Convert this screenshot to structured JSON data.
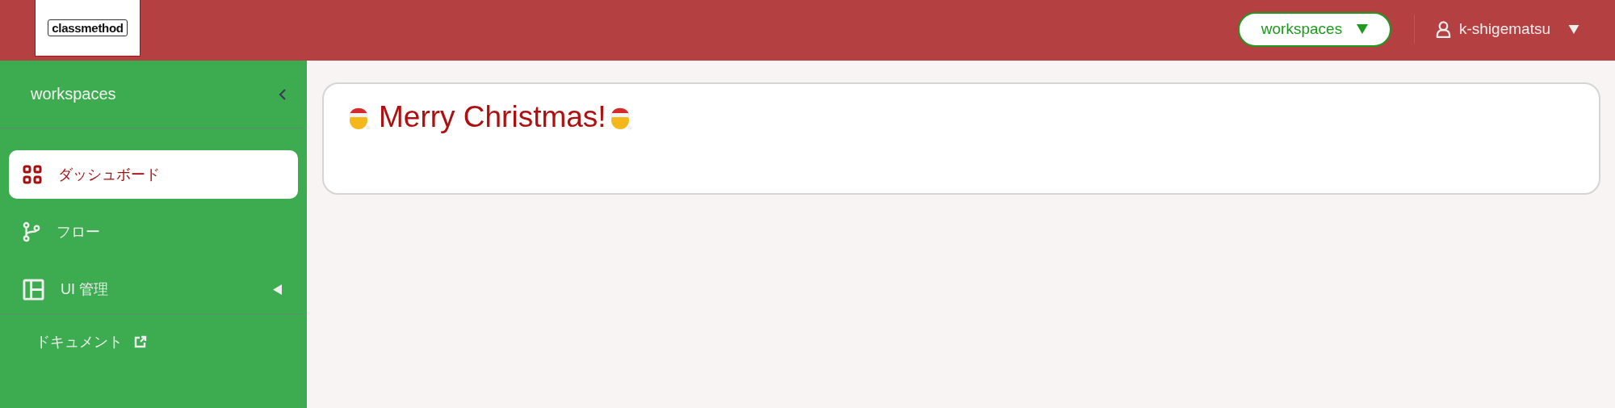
{
  "header": {
    "logo": "classmethod",
    "workspace_button": "workspaces",
    "user": "k-shigematsu"
  },
  "sidebar": {
    "title": "workspaces",
    "items": [
      {
        "label": "ダッシュボード",
        "selected": true
      },
      {
        "label": "フロー",
        "selected": false
      },
      {
        "label": "UI 管理",
        "selected": false,
        "expanded": false
      }
    ],
    "footer_link": "ドキュメント"
  },
  "card": {
    "title": "Merry Christmas!"
  }
}
